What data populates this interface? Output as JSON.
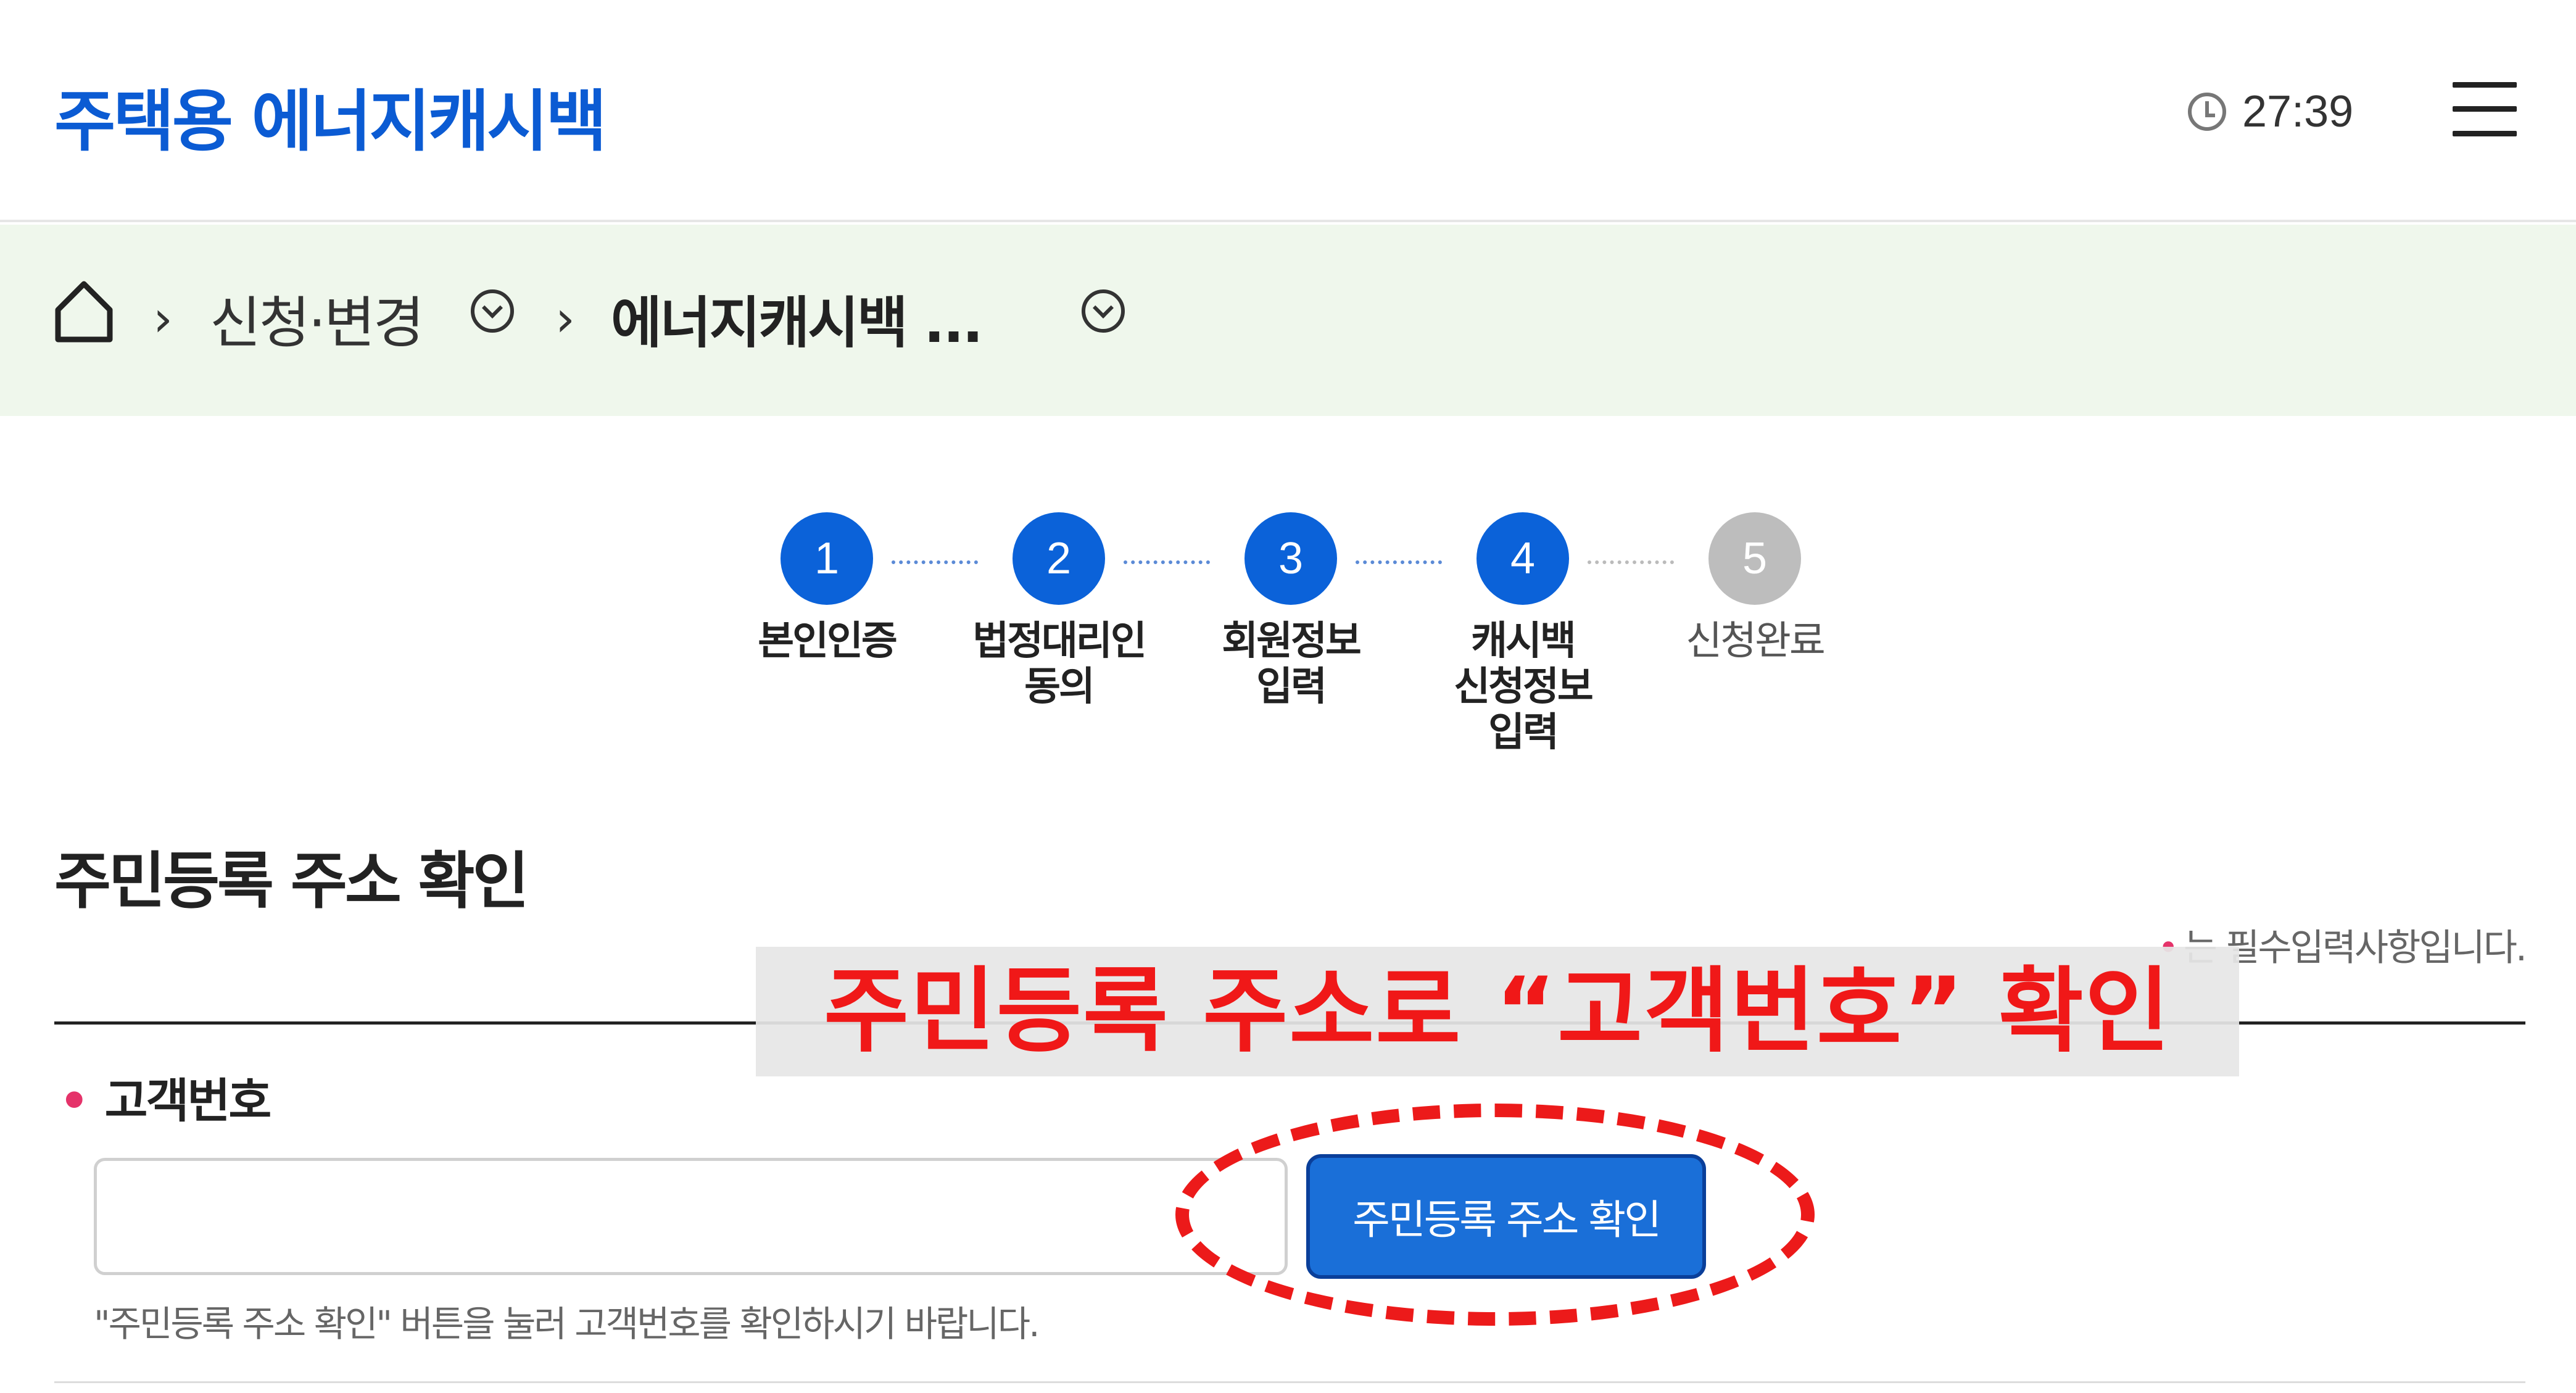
{
  "header": {
    "logo": "주택용 에너지캐시백",
    "timer": "27:39",
    "timer_icon": "clock-icon",
    "menu_icon": "hamburger-menu-icon"
  },
  "breadcrumb": {
    "home_icon": "home-icon",
    "items": [
      {
        "label": "신청·변경",
        "icon": "chevron-down-circle-icon"
      },
      {
        "label": "에너지캐시백 ...",
        "icon": "chevron-down-circle-icon"
      }
    ]
  },
  "steps": [
    {
      "number": "1",
      "label": "본인인증",
      "state": "done"
    },
    {
      "number": "2",
      "label": "법정대리인\n동의",
      "state": "done"
    },
    {
      "number": "3",
      "label": "회원정보\n입력",
      "state": "done"
    },
    {
      "number": "4",
      "label": "캐시백\n신청정보\n입력",
      "state": "current"
    },
    {
      "number": "5",
      "label": "신청완료",
      "state": "pending"
    }
  ],
  "section": {
    "title": "주민등록 주소 확인",
    "required_note_marker": "•",
    "required_note": "는 필수입력사항입니다."
  },
  "field": {
    "required_marker": "•",
    "label": "고객번호",
    "value": "",
    "button": "주민등록 주소 확인",
    "help": "\"주민등록 주소 확인\" 버튼을 눌러 고객번호를 확인하시기 바랍니다."
  },
  "annotation": {
    "banner": "주민등록 주소로 “고객번호” 확인",
    "color": "#f01818"
  },
  "colors": {
    "brand": "#0b5bd3",
    "step_active": "#0b62d9",
    "step_pending": "#bdbdbd",
    "breadcrumb_bg": "#eff7ec",
    "required": "#e5336a"
  }
}
